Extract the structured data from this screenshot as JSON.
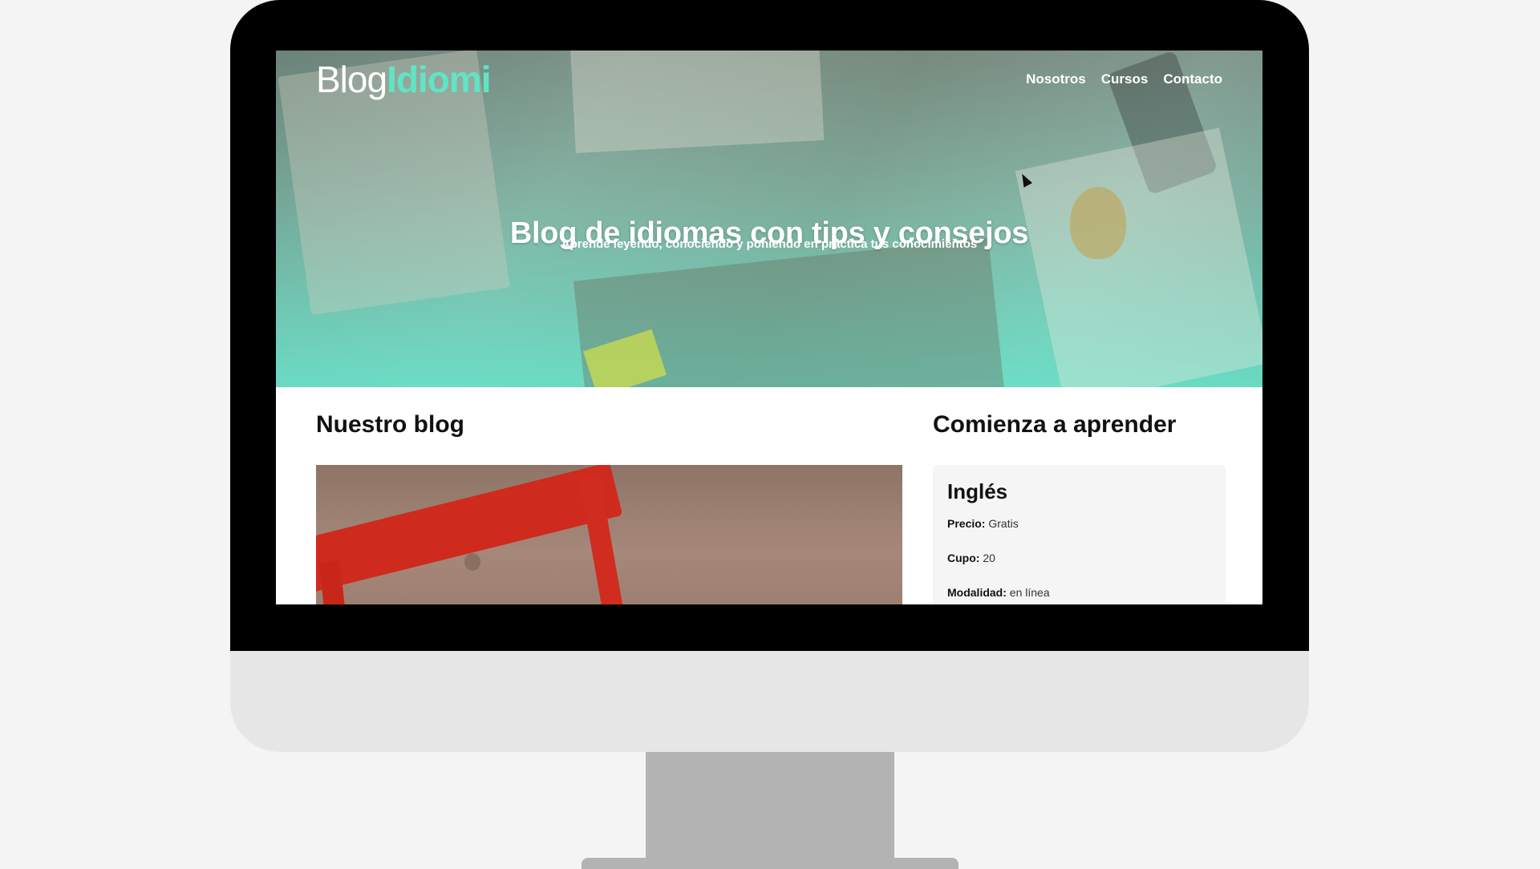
{
  "site": {
    "logo_part1": "Blog",
    "logo_part2": "Idiomi",
    "nav": [
      {
        "label": "Nosotros"
      },
      {
        "label": "Cursos"
      },
      {
        "label": "Contacto"
      }
    ]
  },
  "hero": {
    "title": "Blog de idiomas con tips y consejos",
    "subtitle": "Aprende leyendo, conociendo y poniendo en práctica tus conocimientos"
  },
  "blog": {
    "heading": "Nuestro blog"
  },
  "courses": {
    "heading": "Comienza a aprender",
    "items": [
      {
        "name": "Inglés",
        "price_label": "Precio:",
        "price_value": "Gratis",
        "capacity_label": "Cupo:",
        "capacity_value": "20",
        "mode_label": "Modalidad:",
        "mode_value": "en línea"
      }
    ]
  },
  "colors": {
    "accent": "#5fe5c5",
    "hero_tint": "#64e1c8",
    "bezel": "#000000",
    "chin": "#e6e6e6",
    "stand": "#b3b3b3"
  }
}
